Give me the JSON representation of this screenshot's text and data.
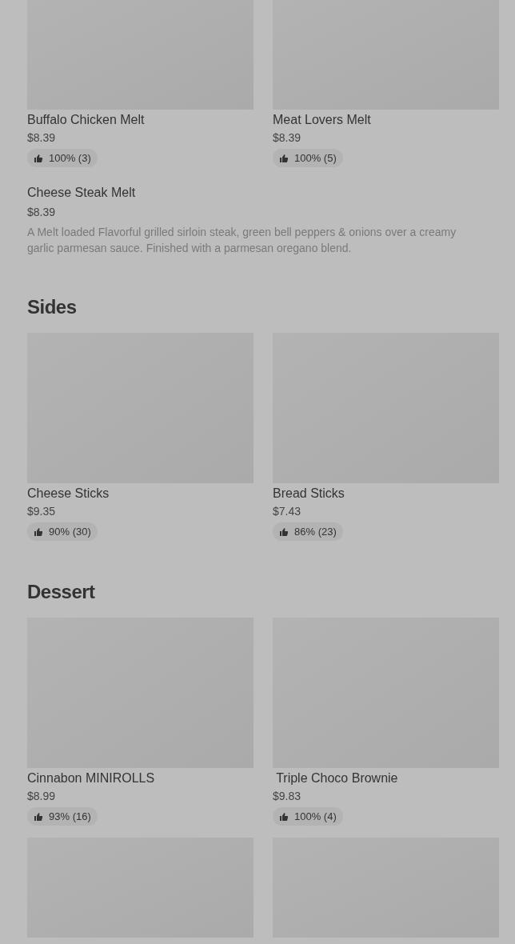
{
  "sections": [
    {
      "items": [
        {
          "kind": "card",
          "name": "Buffalo Chicken Melt",
          "price": "$8.39",
          "rating": "100% (3)"
        },
        {
          "kind": "card",
          "name": "Meat Lovers Melt",
          "price": "$8.39",
          "rating": "100% (5)"
        },
        {
          "kind": "text",
          "name": "Cheese Steak Melt",
          "price": "$8.39",
          "description": "A Melt loaded Flavorful grilled sirloin steak, green bell peppers & onions over a creamy garlic parmesan sauce. Finished with a parmesan oregano blend."
        }
      ]
    },
    {
      "title": "Sides",
      "items": [
        {
          "kind": "card",
          "name": "Cheese Sticks",
          "price": "$9.35",
          "rating": "90% (30)"
        },
        {
          "kind": "card",
          "name": "Bread Sticks",
          "price": "$7.43",
          "rating": "86% (23)"
        }
      ]
    },
    {
      "title": "Dessert",
      "items": [
        {
          "kind": "card",
          "name": "Cinnabon MINIROLLS",
          "price": "$8.99",
          "rating": "93% (16)"
        },
        {
          "kind": "card",
          "name": " Triple Choco Brownie",
          "price": "$9.83",
          "rating": "100% (4)"
        },
        {
          "kind": "image_only"
        },
        {
          "kind": "image_only"
        }
      ]
    }
  ]
}
